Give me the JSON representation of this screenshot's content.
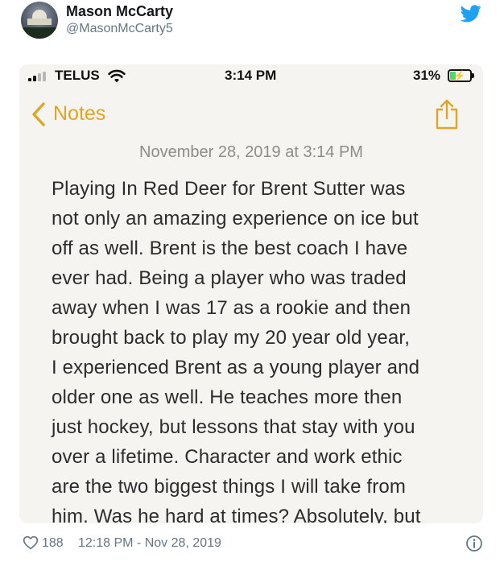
{
  "tweet": {
    "display_name": "Mason McCarty",
    "handle": "@MasonMcCarty5",
    "likes": "188",
    "timestamp": "12:18 PM - Nov 28, 2019",
    "brand_color": "#1da1f2"
  },
  "phone": {
    "carrier": "TELUS",
    "time": "3:14 PM",
    "battery_percent": "31%",
    "battery_level": 0.31,
    "signal_bars_filled": 2,
    "signal_bars_total": 4
  },
  "notes": {
    "back_label": "Notes",
    "accent_color": "#e0a526",
    "date": "November 28, 2019 at 3:14 PM",
    "lines": [
      "Playing In Red Deer for Brent Sutter was",
      "not only an amazing experience on ice but",
      "off as well. Brent is the best coach I have",
      "ever had. Being a player who was traded",
      "away when I was 17 as a rookie and then",
      "brought back to play my 20 year old year,",
      "I experienced Brent as a young player and",
      "older one as well. He teaches more then",
      "just hockey, but lessons that stay with you",
      "over a lifetime. Character and work ethic",
      "are the two biggest things I will take from",
      "him. Was he hard at times? Absolutely, but"
    ]
  },
  "icons": {
    "bird": "twitter-bird-icon",
    "heart": "heart-icon",
    "info": "info-icon",
    "share": "share-icon",
    "back": "chevron-left-icon",
    "wifi": "wifi-icon"
  }
}
